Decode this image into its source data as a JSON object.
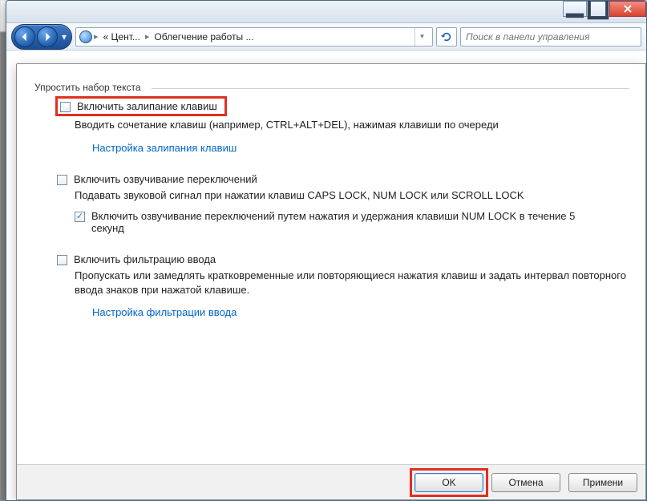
{
  "breadcrumb": {
    "seg1": "« Цент...",
    "seg2": "Облегчение работы ...",
    "sep": "▸"
  },
  "search": {
    "placeholder": "Поиск в панели управления"
  },
  "section": {
    "title": "Упростить набор текста"
  },
  "sticky": {
    "label": "Включить залипание клавиш",
    "desc": "Вводить сочетание клавиш (например, CTRL+ALT+DEL), нажимая клавиши по очереди",
    "link": "Настройка залипания клавиш"
  },
  "toggle": {
    "label": "Включить озвучивание переключений",
    "desc": "Подавать звуковой сигнал при нажатии клавиш CAPS LOCK, NUM LOCK или SCROLL LOCK",
    "sub_label": "Включить озвучивание переключений путем нажатия и удержания клавиши NUM LOCK в течение 5 секунд"
  },
  "filter": {
    "label": "Включить фильтрацию ввода",
    "desc": "Пропускать или замедлять кратковременные или повторяющиеся нажатия клавиш и задать интервал повторного ввода знаков при нажатой клавише.",
    "link": "Настройка фильтрации ввода"
  },
  "buttons": {
    "ok": "OK",
    "cancel": "Отмена",
    "apply": "Примени"
  }
}
